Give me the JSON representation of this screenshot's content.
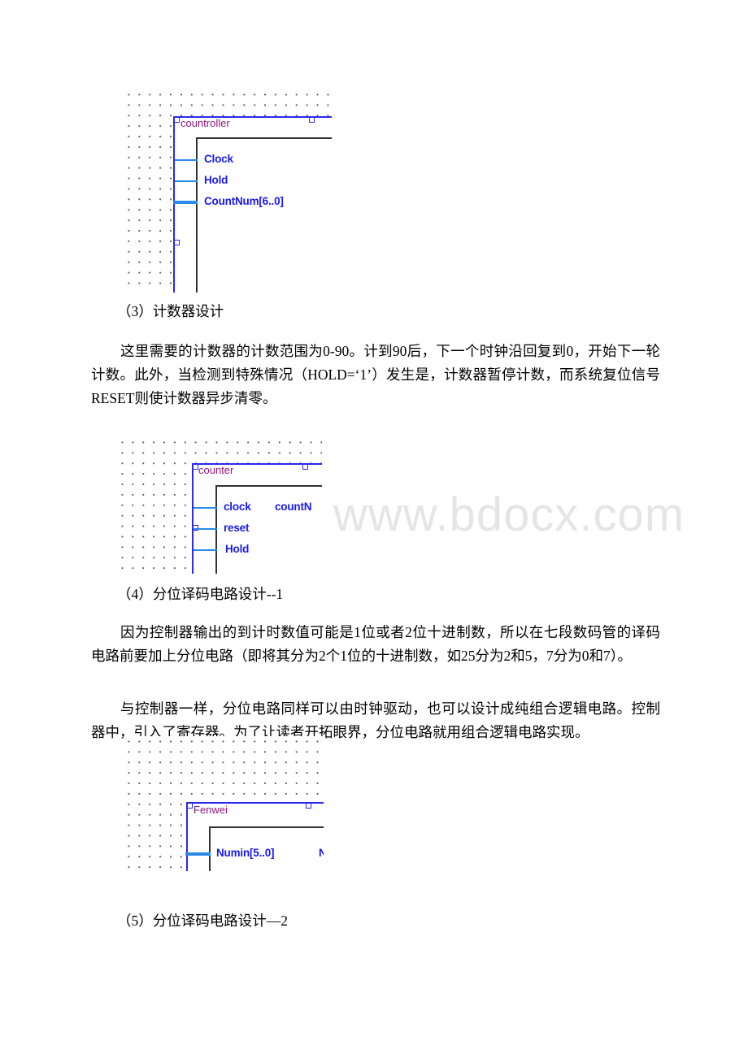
{
  "figures": {
    "controller": {
      "title": "countroller",
      "ports": [
        "Clock",
        "Hold",
        "CountNum[6..0]"
      ]
    },
    "counter": {
      "title": "counter",
      "ports_left": [
        "clock",
        "reset",
        "Hold"
      ],
      "ports_right": [
        "countN"
      ]
    },
    "fenwei": {
      "title": "Fenwei",
      "ports_left": [
        "Numin[5..0]"
      ],
      "ports_right": [
        "N"
      ]
    }
  },
  "sections": {
    "s3_heading": "（3）计数器设计",
    "s3_para": "这里需要的计数器的计数范围为0-90。计到90后，下一个时钟沿回复到0，开始下一轮计数。此外，当检测到特殊情况（HOLD=‘1’）发生是，计数器暂停计数，而系统复位信号RESET则使计数器异步清零。",
    "s4_heading": "（4）分位译码电路设计--1",
    "s4_para1": "因为控制器输出的到计时数值可能是1位或者2位十进制数，所以在七段数码管的译码电路前要加上分位电路（即将其分为2个1位的十进制数，如25分为2和5，7分为0和7）。",
    "s4_para2": "与控制器一样，分位电路同样可以由时钟驱动，也可以设计成纯组合逻辑电路。控制器中，引入了寄存器。为了让读者开拓眼界，分位电路就用组合逻辑电路实现。",
    "s5_heading": "（5）分位译码电路设计—2"
  },
  "watermark": "www.bdocx.com"
}
